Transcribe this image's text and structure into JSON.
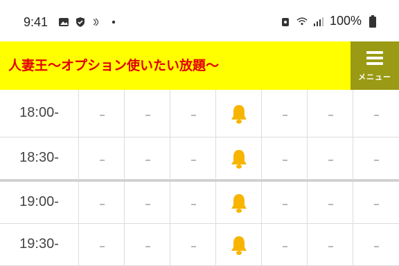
{
  "status_bar": {
    "time": "9:41",
    "battery": "100%"
  },
  "header": {
    "title": "人妻王〜オプション使いたい放題〜",
    "menu_label": "メニュー"
  },
  "schedule": {
    "rows": [
      {
        "time": "18:00-",
        "slots": [
          "-",
          "-",
          "-",
          "bell",
          "-",
          "-",
          "-"
        ]
      },
      {
        "time": "18:30-",
        "slots": [
          "-",
          "-",
          "-",
          "bell",
          "-",
          "-",
          "-"
        ]
      },
      {
        "time": "19:00-",
        "slots": [
          "-",
          "-",
          "-",
          "bell",
          "-",
          "-",
          "-"
        ]
      },
      {
        "time": "19:30-",
        "slots": [
          "-",
          "-",
          "-",
          "bell",
          "-",
          "-",
          "-"
        ]
      }
    ]
  },
  "colors": {
    "header_bg": "#ffff00",
    "title": "#e10000",
    "menu_bg": "#9a9a14",
    "bell": "#f7b500"
  },
  "icons": [
    "gallery-icon",
    "shield-icon",
    "nfc-icon",
    "dot-icon",
    "lock-icon",
    "wifi-icon",
    "signal-icon",
    "battery-icon",
    "menu-icon",
    "bell-icon"
  ]
}
